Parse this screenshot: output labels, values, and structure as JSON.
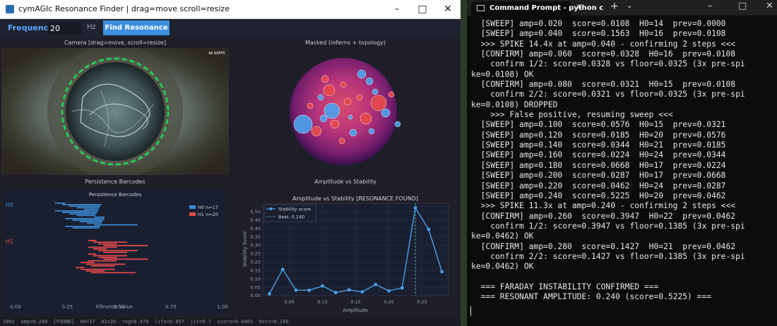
{
  "left_window": {
    "title": "cymAGIc Resonance Finder  |  drag=move  scroll=resize",
    "controls": {
      "minimize": "–",
      "maximize": "□",
      "close": "✕"
    },
    "toolbar": {
      "frequency_label": "Frequency:",
      "frequency_value": "20",
      "unit": "Hz",
      "find_button": "Find Resonance"
    },
    "panels": {
      "camera_title": "Camera  [drag=move, scroll=resize]",
      "camera_overlay": "4K 60FPS",
      "masked_title": "Masked (inferno + topology)",
      "persistence_title": "Persistence Barcodes",
      "stability_title": "Amplitude vs Stability"
    },
    "status_line": "20Hz  amp=0.240  [FOUND]  H0=17  H1=20  reg=0.478  life=0.057  jit=0.7  score=0.0465  best=0.240"
  },
  "chart_data": [
    {
      "type": "barcode",
      "title": "Persistence Barcodes",
      "xlabel": "Filtration Value",
      "xlim": [
        0,
        1
      ],
      "xticks": [
        "0.00",
        "0.25",
        "0.50",
        "0.75",
        "1.00"
      ],
      "groups": [
        {
          "label": "H0",
          "legend": "H0 n=17",
          "color": "#3b8fdb",
          "count": 17
        },
        {
          "label": "H1",
          "legend": "H1 n=20",
          "color": "#e84a4a",
          "count": 20
        }
      ]
    },
    {
      "type": "line",
      "title": "Amplitude vs Stability  [RESONANCE FOUND]",
      "xlabel": "Amplitude",
      "ylabel": "Stability Score",
      "xlim": [
        0.01,
        0.29
      ],
      "ylim": [
        0,
        0.55
      ],
      "xticks": [
        "0.05",
        "0.10",
        "0.15",
        "0.20",
        "0.25"
      ],
      "xtick_values": [
        0.05,
        0.1,
        0.15,
        0.2,
        0.25
      ],
      "yticks": [
        "0.00",
        "0.05",
        "0.10",
        "0.15",
        "0.20",
        "0.25",
        "0.30",
        "0.35",
        "0.40",
        "0.45",
        "0.50"
      ],
      "ytick_values": [
        0,
        0.05,
        0.1,
        0.15,
        0.2,
        0.25,
        0.3,
        0.35,
        0.4,
        0.45,
        0.5
      ],
      "series": [
        {
          "name": "Stability score",
          "color": "#4a9fe8",
          "x": [
            0.02,
            0.04,
            0.06,
            0.08,
            0.1,
            0.12,
            0.14,
            0.16,
            0.18,
            0.2,
            0.22,
            0.24,
            0.26,
            0.28
          ],
          "y": [
            0.0108,
            0.1563,
            0.0328,
            0.0321,
            0.0576,
            0.0185,
            0.0344,
            0.0224,
            0.0668,
            0.0287,
            0.0462,
            0.5225,
            0.3947,
            0.1427
          ]
        }
      ],
      "best_line": {
        "name": "Best: 0.240",
        "x": 0.24,
        "color": "#4caf8c"
      },
      "legend_position": "top-left",
      "grid": true
    }
  ],
  "right_window": {
    "tab_title": "Command Prompt - python c",
    "controls": {
      "tab_close": "✕",
      "new_tab": "+",
      "dropdown": "⌄",
      "minimize": "–",
      "maximize": "□",
      "close": "✕"
    },
    "console_lines": [
      "  [SWEEP] amp=0.020  score=0.0108  H0=14  prev=0.0000",
      "  [SWEEP] amp=0.040  score=0.1563  H0=16  prev=0.0108",
      "  >>> SPIKE 14.4x at amp=0.040 - confirming 2 steps <<<",
      "  [CONFIRM] amp=0.060  score=0.0328  H0=16  prev=0.0108",
      "    confirm 1/2: score=0.0328 vs floor=0.0325 (3x pre-spi",
      "ke=0.0108) OK",
      "  [CONFIRM] amp=0.080  score=0.0321  H0=15  prev=0.0108",
      "    confirm 2/2: score=0.0321 vs floor=0.0325 (3x pre-spi",
      "ke=0.0108) DROPPED",
      "    >>> False positive, resuming sweep <<<",
      "  [SWEEP] amp=0.100  score=0.0576  H0=15  prev=0.0321",
      "  [SWEEP] amp=0.120  score=0.0185  H0=20  prev=0.0576",
      "  [SWEEP] amp=0.140  score=0.0344  H0=21  prev=0.0185",
      "  [SWEEP] amp=0.160  score=0.0224  H0=24  prev=0.0344",
      "  [SWEEP] amp=0.180  score=0.0668  H0=17  prev=0.0224",
      "  [SWEEP] amp=0.200  score=0.0287  H0=17  prev=0.0668",
      "  [SWEEP] amp=0.220  score=0.0462  H0=24  prev=0.0287",
      "  [SWEEP] amp=0.240  score=0.5225  H0=20  prev=0.0462",
      "  >>> SPIKE 11.3x at amp=0.240 - confirming 2 steps <<<",
      "  [CONFIRM] amp=0.260  score=0.3947  H0=22  prev=0.0462",
      "    confirm 1/2: score=0.3947 vs floor=0.1385 (3x pre-spi",
      "ke=0.0462) OK",
      "  [CONFIRM] amp=0.280  score=0.1427  H0=21  prev=0.0462",
      "    confirm 2/2: score=0.1427 vs floor=0.1385 (3x pre-spi",
      "ke=0.0462) OK",
      "",
      "  === FARADAY INSTABILITY CONFIRMED ===",
      "  === RESONANT AMPLITUDE: 0.240 (score=0.5225) ==="
    ]
  },
  "colors": {
    "accent": "#3d8fe0",
    "frequency_label": "#5aa8ff",
    "ring": "#22cc55",
    "h0": "#3b8fdb",
    "h1": "#e84a4a"
  }
}
